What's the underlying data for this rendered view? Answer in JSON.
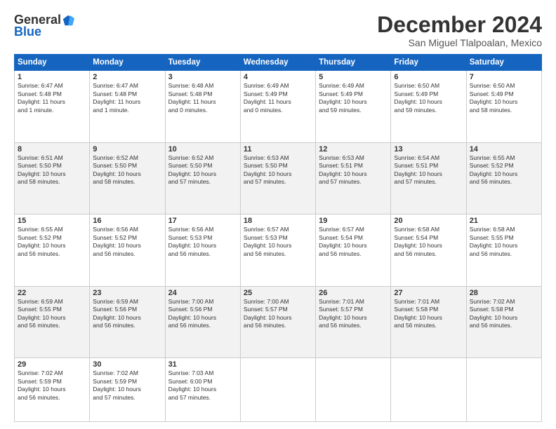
{
  "header": {
    "logo_general": "General",
    "logo_blue": "Blue",
    "month": "December 2024",
    "location": "San Miguel Tlalpoalan, Mexico"
  },
  "days_of_week": [
    "Sunday",
    "Monday",
    "Tuesday",
    "Wednesday",
    "Thursday",
    "Friday",
    "Saturday"
  ],
  "weeks": [
    [
      {
        "day": "1",
        "content": "Sunrise: 6:47 AM\nSunset: 5:48 PM\nDaylight: 11 hours\nand 1 minute."
      },
      {
        "day": "2",
        "content": "Sunrise: 6:47 AM\nSunset: 5:48 PM\nDaylight: 11 hours\nand 1 minute."
      },
      {
        "day": "3",
        "content": "Sunrise: 6:48 AM\nSunset: 5:48 PM\nDaylight: 11 hours\nand 0 minutes."
      },
      {
        "day": "4",
        "content": "Sunrise: 6:49 AM\nSunset: 5:49 PM\nDaylight: 11 hours\nand 0 minutes."
      },
      {
        "day": "5",
        "content": "Sunrise: 6:49 AM\nSunset: 5:49 PM\nDaylight: 10 hours\nand 59 minutes."
      },
      {
        "day": "6",
        "content": "Sunrise: 6:50 AM\nSunset: 5:49 PM\nDaylight: 10 hours\nand 59 minutes."
      },
      {
        "day": "7",
        "content": "Sunrise: 6:50 AM\nSunset: 5:49 PM\nDaylight: 10 hours\nand 58 minutes."
      }
    ],
    [
      {
        "day": "8",
        "content": "Sunrise: 6:51 AM\nSunset: 5:50 PM\nDaylight: 10 hours\nand 58 minutes."
      },
      {
        "day": "9",
        "content": "Sunrise: 6:52 AM\nSunset: 5:50 PM\nDaylight: 10 hours\nand 58 minutes."
      },
      {
        "day": "10",
        "content": "Sunrise: 6:52 AM\nSunset: 5:50 PM\nDaylight: 10 hours\nand 57 minutes."
      },
      {
        "day": "11",
        "content": "Sunrise: 6:53 AM\nSunset: 5:50 PM\nDaylight: 10 hours\nand 57 minutes."
      },
      {
        "day": "12",
        "content": "Sunrise: 6:53 AM\nSunset: 5:51 PM\nDaylight: 10 hours\nand 57 minutes."
      },
      {
        "day": "13",
        "content": "Sunrise: 6:54 AM\nSunset: 5:51 PM\nDaylight: 10 hours\nand 57 minutes."
      },
      {
        "day": "14",
        "content": "Sunrise: 6:55 AM\nSunset: 5:52 PM\nDaylight: 10 hours\nand 56 minutes."
      }
    ],
    [
      {
        "day": "15",
        "content": "Sunrise: 6:55 AM\nSunset: 5:52 PM\nDaylight: 10 hours\nand 56 minutes."
      },
      {
        "day": "16",
        "content": "Sunrise: 6:56 AM\nSunset: 5:52 PM\nDaylight: 10 hours\nand 56 minutes."
      },
      {
        "day": "17",
        "content": "Sunrise: 6:56 AM\nSunset: 5:53 PM\nDaylight: 10 hours\nand 56 minutes."
      },
      {
        "day": "18",
        "content": "Sunrise: 6:57 AM\nSunset: 5:53 PM\nDaylight: 10 hours\nand 56 minutes."
      },
      {
        "day": "19",
        "content": "Sunrise: 6:57 AM\nSunset: 5:54 PM\nDaylight: 10 hours\nand 56 minutes."
      },
      {
        "day": "20",
        "content": "Sunrise: 6:58 AM\nSunset: 5:54 PM\nDaylight: 10 hours\nand 56 minutes."
      },
      {
        "day": "21",
        "content": "Sunrise: 6:58 AM\nSunset: 5:55 PM\nDaylight: 10 hours\nand 56 minutes."
      }
    ],
    [
      {
        "day": "22",
        "content": "Sunrise: 6:59 AM\nSunset: 5:55 PM\nDaylight: 10 hours\nand 56 minutes."
      },
      {
        "day": "23",
        "content": "Sunrise: 6:59 AM\nSunset: 5:56 PM\nDaylight: 10 hours\nand 56 minutes."
      },
      {
        "day": "24",
        "content": "Sunrise: 7:00 AM\nSunset: 5:56 PM\nDaylight: 10 hours\nand 56 minutes."
      },
      {
        "day": "25",
        "content": "Sunrise: 7:00 AM\nSunset: 5:57 PM\nDaylight: 10 hours\nand 56 minutes."
      },
      {
        "day": "26",
        "content": "Sunrise: 7:01 AM\nSunset: 5:57 PM\nDaylight: 10 hours\nand 56 minutes."
      },
      {
        "day": "27",
        "content": "Sunrise: 7:01 AM\nSunset: 5:58 PM\nDaylight: 10 hours\nand 56 minutes."
      },
      {
        "day": "28",
        "content": "Sunrise: 7:02 AM\nSunset: 5:58 PM\nDaylight: 10 hours\nand 56 minutes."
      }
    ],
    [
      {
        "day": "29",
        "content": "Sunrise: 7:02 AM\nSunset: 5:59 PM\nDaylight: 10 hours\nand 56 minutes."
      },
      {
        "day": "30",
        "content": "Sunrise: 7:02 AM\nSunset: 5:59 PM\nDaylight: 10 hours\nand 57 minutes."
      },
      {
        "day": "31",
        "content": "Sunrise: 7:03 AM\nSunset: 6:00 PM\nDaylight: 10 hours\nand 57 minutes."
      },
      {
        "day": "",
        "content": ""
      },
      {
        "day": "",
        "content": ""
      },
      {
        "day": "",
        "content": ""
      },
      {
        "day": "",
        "content": ""
      }
    ]
  ]
}
